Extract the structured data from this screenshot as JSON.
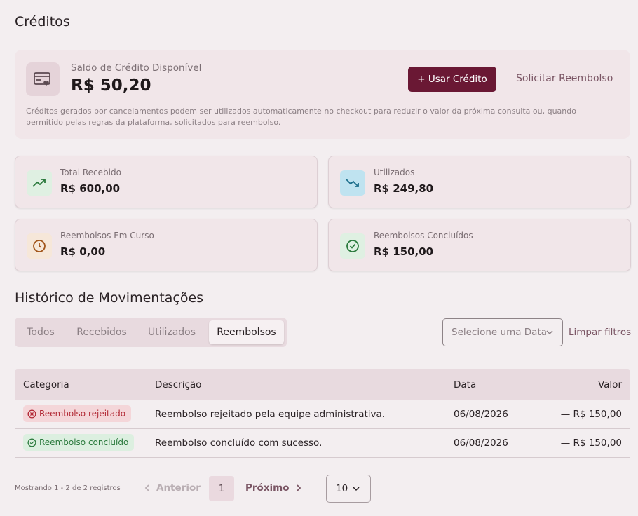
{
  "page": {
    "title": "Créditos"
  },
  "credit": {
    "label": "Saldo de Crédito Disponível",
    "amount": "R$ 50,20",
    "use_button": "+ Usar Crédito",
    "refund_link": "Solicitar Reembolso",
    "description": "Créditos gerados por cancelamentos podem ser utilizados automaticamente no checkout para reduzir o valor da próxima consulta ou, quando permitido pelas regras da plataforma, solicitados para reembolso.",
    "icon": "credit-card-heart-icon"
  },
  "stats": [
    {
      "label": "Total Recebido",
      "value": "R$ 600,00",
      "icon": "trending-up-icon",
      "icon_bg": "#dff0e2",
      "icon_color": "#2b7a3d"
    },
    {
      "label": "Utilizados",
      "value": "R$ 249,80",
      "icon": "trending-down-icon",
      "icon_bg": "#bfe3f0",
      "icon_color": "#1d6f8c"
    },
    {
      "label": "Reembolsos Em Curso",
      "value": "R$ 0,00",
      "icon": "clock-icon",
      "icon_bg": "#f6e7d9",
      "icon_color": "#a2561c"
    },
    {
      "label": "Reembolsos Concluídos",
      "value": "R$ 150,00",
      "icon": "check-circle-icon",
      "icon_bg": "#dff0e2",
      "icon_color": "#2b7a3d"
    }
  ],
  "history": {
    "title": "Histórico de Movimentações",
    "tabs": [
      "Todos",
      "Recebidos",
      "Utilizados",
      "Reembolsos"
    ],
    "active_tab": "Reembolsos",
    "date_placeholder": "Selecione uma Data",
    "clear_filters": "Limpar filtros"
  },
  "table": {
    "columns": [
      "Categoria",
      "Descrição",
      "Data",
      "Valor"
    ],
    "rows": [
      {
        "category": "Reembolso rejeitado",
        "status": "rejected",
        "description": "Reembolso rejeitado pela equipe administrativa.",
        "date": "06/08/2026",
        "value": "— R$ 150,00"
      },
      {
        "category": "Reembolso concluído",
        "status": "done",
        "description": "Reembolso concluído com sucesso.",
        "date": "06/08/2026",
        "value": "— R$ 150,00"
      }
    ]
  },
  "pagination": {
    "showing": "Mostrando 1 - 2 de 2 registros",
    "prev": "Anterior",
    "current": "1",
    "next": "Próximo",
    "per_page": "10"
  }
}
